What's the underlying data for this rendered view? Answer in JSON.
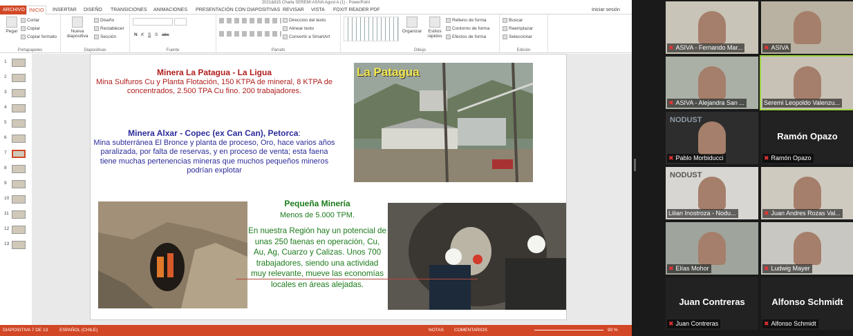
{
  "window_title": "2021&815 Charla SEREMI ASIVA Agost A (1) - PowerPoint",
  "tabs": [
    "ARCHIVO",
    "INICIO",
    "INSERTAR",
    "DISEÑO",
    "TRANSICIONES",
    "ANIMACIONES",
    "PRESENTACIÓN CON DIAPOSITIVAS",
    "REVISAR",
    "VISTA",
    "FOXIT READER PDF"
  ],
  "sign_in": "Iniciar sesión",
  "ribbon": {
    "portapapeles": {
      "label": "Portapapeles",
      "pegar": "Pegar",
      "cortar": "Cortar",
      "copiar": "Copiar",
      "copiar_formato": "Copiar formato"
    },
    "diapositivas": {
      "label": "Diapositivas",
      "nueva": "Nueva diapositiva",
      "diseno": "Diseño",
      "restablecer": "Restablecer",
      "seccion": "Sección"
    },
    "fuente": {
      "label": "Fuente",
      "bold": "N",
      "italic": "K",
      "underline": "S",
      "strike": "S",
      "abc": "abc"
    },
    "parrafo": {
      "label": "Párrafo",
      "direccion": "Dirección del texto",
      "alinear": "Alinear texto",
      "smartart": "Convertir a SmartArt"
    },
    "dibujo": {
      "label": "Dibujo",
      "organizar": "Organizar",
      "estilos": "Estilos rápidos",
      "relleno": "Relleno de forma",
      "contorno": "Contorno de forma",
      "efectos": "Efectos de forma"
    },
    "edicion": {
      "label": "Edición",
      "buscar": "Buscar",
      "reemplazar": "Reemplazar",
      "seleccionar": "Seleccionar"
    }
  },
  "thumbnails": [
    "1",
    "2",
    "3",
    "4",
    "5",
    "6",
    "7",
    "8",
    "9",
    "10",
    "11",
    "12",
    "13"
  ],
  "selected_slide": 7,
  "slide": {
    "block1_title": "Minera La Patagua - La Ligua",
    "block1_body": "Mina Sulfuros Cu y Planta Flotación, 150 KTPA de mineral, 8 KTPA de concentrados, 2.500 TPA Cu fino.  200 trabajadores.",
    "block2_title": "Minera Alxar - Copec (ex Can Can), Petorca",
    "block2_colon": ":",
    "block2_body": "Mina subterránea El Bronce y planta de proceso, Oro, hace varios años paralizada, por falta de reservas, y en proceso de venta; esta faena tiene muchas pertenencias mineras que muchos pequeños mineros podrían explotar",
    "photo1_label": "La Patagua",
    "block3_title": "Pequeña Minería",
    "block3_sub": "Menos de 5.000 TPM.",
    "block3_body": "En nuestra Región hay un potencial de unas 250 faenas en operación, Cu, Au, Ag, Cuarzo y Calizas. Unos 700 trabajadores, siendo una actividad muy relevante, mueve las economías locales en áreas alejadas."
  },
  "status": {
    "slide_of": "DIAPOSITIVA 7 DE 13",
    "language": "ESPAÑOL (CHILE)",
    "notas": "NOTAS",
    "comentarios": "COMENTARIOS",
    "zoom": "90 %"
  },
  "participants": [
    {
      "name": "ASIVA - Fernando Mar...",
      "muted": true
    },
    {
      "name": "ASIVA",
      "muted": true
    },
    {
      "name": "ASIVA - Alejandra San ...",
      "muted": true
    },
    {
      "name": "Seremi Leopoldo Valenzu...",
      "muted": false,
      "speaking": true
    },
    {
      "name": "Pablo Morbiducci",
      "muted": true,
      "bg_text": "NODUST"
    },
    {
      "name": "Ramón Opazo",
      "muted": true,
      "big_name": "Ramón Opazo"
    },
    {
      "name": "Lilian Inostroza - Nodu...",
      "muted": false,
      "bg_text": "NODUST"
    },
    {
      "name": "Juan Andres Rozas Val...",
      "muted": true
    },
    {
      "name": "Elías Mohor",
      "muted": true
    },
    {
      "name": "Ludwig Mayer",
      "muted": true
    },
    {
      "name": "Juan Contreras",
      "muted": true,
      "big_name": "Juan Contreras"
    },
    {
      "name": "Alfonso Schmidt",
      "muted": true,
      "big_name": "Alfonso Schmidt"
    }
  ],
  "colors": {
    "accent": "#d24726",
    "speaking": "#9bd33f"
  }
}
